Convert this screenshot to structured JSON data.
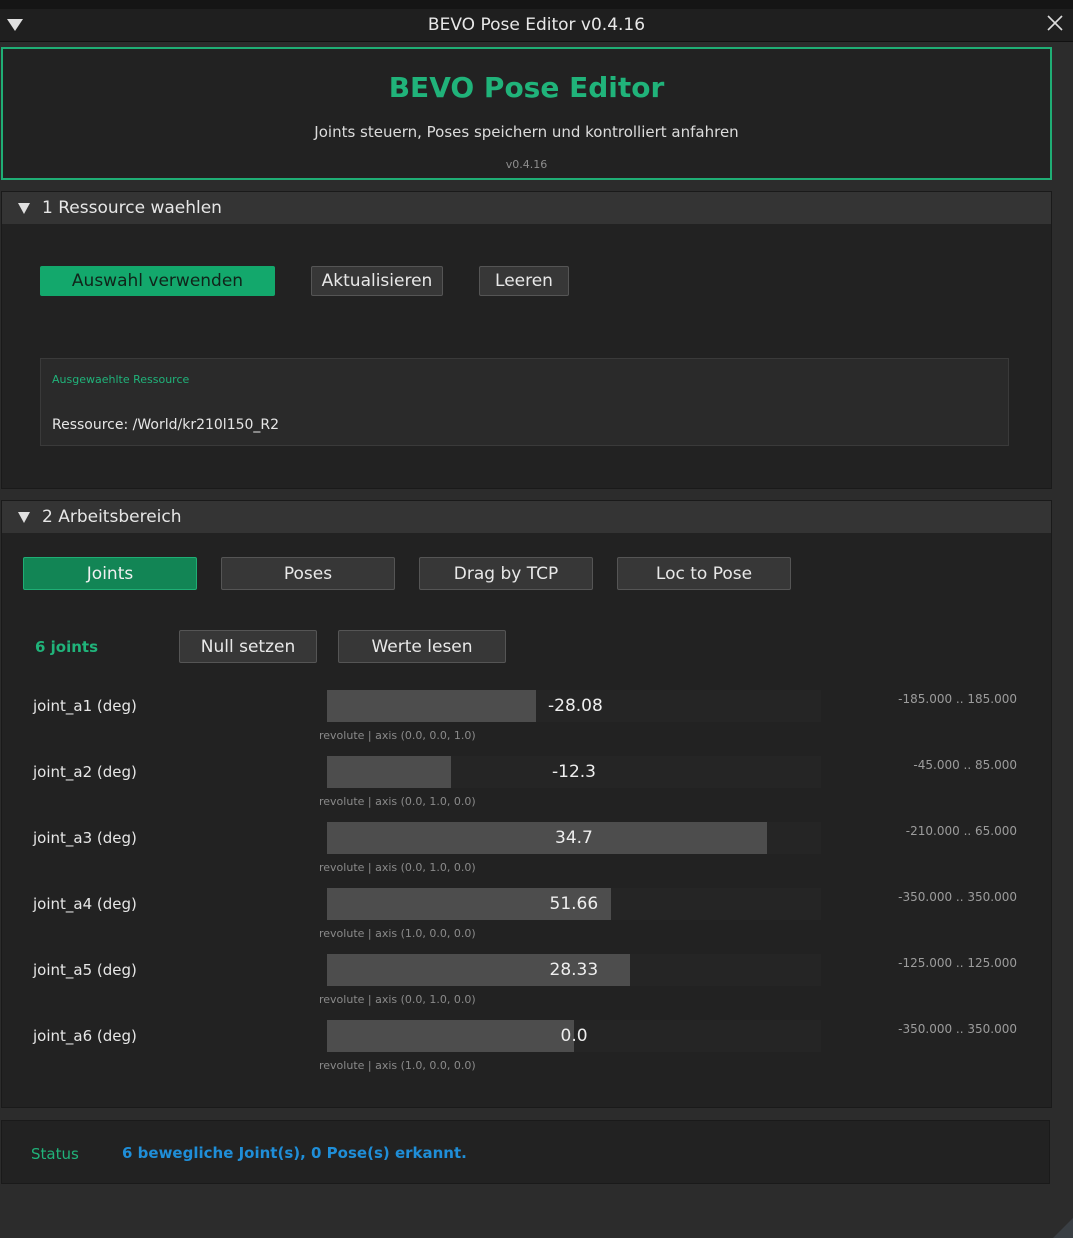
{
  "window": {
    "title": "BEVO Pose Editor v0.4.16"
  },
  "header": {
    "title": "BEVO Pose Editor",
    "subtitle": "Joints steuern, Poses speichern und kontrolliert anfahren",
    "version": "v0.4.16"
  },
  "section1": {
    "title": "1  Ressource waehlen",
    "buttons": {
      "use_selection": "Auswahl verwenden",
      "refresh": "Aktualisieren",
      "clear": "Leeren"
    },
    "resource_box": {
      "heading": "Ausgewaehlte Ressource",
      "value": "Ressource: /World/kr210l150_R2"
    }
  },
  "section2": {
    "title": "2  Arbeitsbereich",
    "tabs": [
      "Joints",
      "Poses",
      "Drag by TCP",
      "Loc to Pose"
    ],
    "active_tab": "Joints",
    "joint_count": "6 joints",
    "buttons": {
      "zero": "Null setzen",
      "read": "Werte lesen"
    },
    "joints": [
      {
        "label": "joint_a1 (deg)",
        "value": "-28.08",
        "min": -185,
        "max": 185,
        "fill_fraction": 0.424,
        "info": "revolute | axis (0.0, 0.0, 1.0)",
        "range": "-185.000 .. 185.000"
      },
      {
        "label": "joint_a2 (deg)",
        "value": "-12.3",
        "min": -45,
        "max": 85,
        "fill_fraction": 0.252,
        "info": "revolute | axis (0.0, 1.0, 0.0)",
        "range": "-45.000 .. 85.000"
      },
      {
        "label": "joint_a3 (deg)",
        "value": "34.7",
        "min": -210,
        "max": 65,
        "fill_fraction": 0.891,
        "info": "revolute | axis (0.0, 1.0, 0.0)",
        "range": "-210.000 .. 65.000"
      },
      {
        "label": "joint_a4 (deg)",
        "value": "51.66",
        "min": -350,
        "max": 350,
        "fill_fraction": 0.574,
        "info": "revolute | axis (1.0, 0.0, 0.0)",
        "range": "-350.000 .. 350.000"
      },
      {
        "label": "joint_a5 (deg)",
        "value": "28.33",
        "min": -125,
        "max": 125,
        "fill_fraction": 0.613,
        "info": "revolute | axis (0.0, 1.0, 0.0)",
        "range": "-125.000 .. 125.000"
      },
      {
        "label": "joint_a6 (deg)",
        "value": "0.0",
        "min": -350,
        "max": 350,
        "fill_fraction": 0.5,
        "info": "revolute | axis (1.0, 0.0, 0.0)",
        "range": "-350.000 .. 350.000"
      }
    ]
  },
  "status": {
    "label": "Status",
    "text": "6 bewegliche Joint(s), 0 Pose(s) erkannt."
  },
  "colors": {
    "accent": "#20b37a",
    "status_text": "#1f8ed8"
  }
}
